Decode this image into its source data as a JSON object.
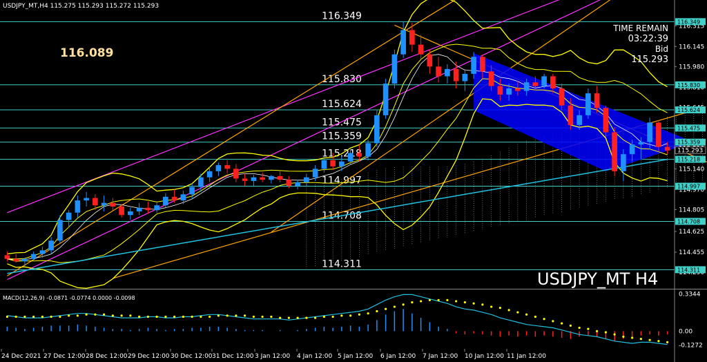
{
  "header": {
    "ohlc_text": "USDJPY_MT,H4  115.275 115.293 115.272 115.293"
  },
  "big_price": "116.089",
  "info": {
    "time_label": "TIME REMAIN",
    "time_value": "03:22:39",
    "bid_label": "Bid",
    "bid_value": "115.293"
  },
  "watermark": "USDJPY_MT H4",
  "macd_header": "MACD(12,26,9) -0.0871 -0.0774 0.0000 -0.0098",
  "colors": {
    "bg": "#000000",
    "bull": "#1e90ff",
    "bear": "#ff2020",
    "level": "#40d0c8",
    "envelope": "#ffff00",
    "channel_outer": "#ff30ff",
    "channel_inner": "#ffa500",
    "triangle": "#0000ff",
    "ema": "#20c0e0",
    "macd_signal": "#ffff00",
    "macd_line": "#20c0e0"
  },
  "chart_data": {
    "type": "candlestick",
    "symbol": "USDJPY_MT",
    "timeframe": "H4",
    "ylim": [
      114.16,
      116.47
    ],
    "y_ticks": [
      "116.315",
      "116.145",
      "115.980",
      "115.810",
      "115.645",
      "115.475",
      "115.310",
      "115.140",
      "114.970",
      "114.805",
      "114.625",
      "114.455",
      "114.290"
    ],
    "x_ticks": [
      "24 Dec 2021",
      "27 Dec 12:00",
      "28 Dec 12:00",
      "29 Dec 12:00",
      "30 Dec 12:00",
      "31 Dec 12:00",
      "3 Jan 12:00",
      "4 Jan 12:00",
      "5 Jan 12:00",
      "6 Jan 12:00",
      "7 Jan 12:00",
      "10 Jan 12:00",
      "11 Jan 12:00"
    ],
    "levels": [
      {
        "value": 116.349,
        "label": "116.349",
        "tag": "116.349"
      },
      {
        "value": 115.83,
        "label": "115.830",
        "tag": "115.830"
      },
      {
        "value": 115.624,
        "label": "115.624",
        "tag": "115.624"
      },
      {
        "value": 115.475,
        "label": "115.475",
        "tag": "115.475"
      },
      {
        "value": 115.359,
        "label": "115.359",
        "tag": "115.359"
      },
      {
        "value": 115.218,
        "label": "115.218",
        "tag": "115.218"
      },
      {
        "value": 114.997,
        "label": "114.997",
        "tag": "114.997"
      },
      {
        "value": 114.708,
        "label": "114.708",
        "tag": "114.708"
      },
      {
        "value": 114.311,
        "label": "114.311",
        "tag": "114.311"
      }
    ],
    "current_price": {
      "value": 115.293,
      "tag": "115.293"
    },
    "candles": [
      [
        114.43,
        114.46,
        114.38,
        114.4
      ],
      [
        114.4,
        114.44,
        114.37,
        114.38
      ],
      [
        114.38,
        114.41,
        114.34,
        114.4
      ],
      [
        114.4,
        114.46,
        114.39,
        114.44
      ],
      [
        114.44,
        114.5,
        114.41,
        114.47
      ],
      [
        114.47,
        114.58,
        114.44,
        114.55
      ],
      [
        114.55,
        114.76,
        114.53,
        114.72
      ],
      [
        114.72,
        114.8,
        114.66,
        114.78
      ],
      [
        114.78,
        114.92,
        114.74,
        114.88
      ],
      [
        114.88,
        114.95,
        114.83,
        114.9
      ],
      [
        114.9,
        114.93,
        114.8,
        114.84
      ],
      [
        114.84,
        114.92,
        114.79,
        114.86
      ],
      [
        114.86,
        114.9,
        114.8,
        114.83
      ],
      [
        114.83,
        114.85,
        114.74,
        114.76
      ],
      [
        114.76,
        114.82,
        114.72,
        114.79
      ],
      [
        114.79,
        114.86,
        114.76,
        114.82
      ],
      [
        114.82,
        114.87,
        114.77,
        114.8
      ],
      [
        114.8,
        114.86,
        114.78,
        114.84
      ],
      [
        114.84,
        114.94,
        114.82,
        114.91
      ],
      [
        114.91,
        114.97,
        114.86,
        114.88
      ],
      [
        114.88,
        114.96,
        114.85,
        114.93
      ],
      [
        114.93,
        115.02,
        114.89,
        114.99
      ],
      [
        114.99,
        115.1,
        114.95,
        115.07
      ],
      [
        115.07,
        115.16,
        115.03,
        115.12
      ],
      [
        115.12,
        115.19,
        115.08,
        115.17
      ],
      [
        115.17,
        115.21,
        115.1,
        115.14
      ],
      [
        115.14,
        115.18,
        115.03,
        115.06
      ],
      [
        115.06,
        115.1,
        115.0,
        115.04
      ],
      [
        115.04,
        115.09,
        115.0,
        115.07
      ],
      [
        115.07,
        115.11,
        115.03,
        115.05
      ],
      [
        115.05,
        115.09,
        115.02,
        115.08
      ],
      [
        115.08,
        115.12,
        115.03,
        115.05
      ],
      [
        115.05,
        115.08,
        114.98,
        115.0
      ],
      [
        115.0,
        115.05,
        114.97,
        115.03
      ],
      [
        115.03,
        115.1,
        115.0,
        115.07
      ],
      [
        115.07,
        115.17,
        115.04,
        115.14
      ],
      [
        115.14,
        115.25,
        115.11,
        115.21
      ],
      [
        115.21,
        115.27,
        115.13,
        115.16
      ],
      [
        115.16,
        115.24,
        115.12,
        115.2
      ],
      [
        115.2,
        115.3,
        115.17,
        115.27
      ],
      [
        115.27,
        115.34,
        115.2,
        115.24
      ],
      [
        115.24,
        115.38,
        115.21,
        115.35
      ],
      [
        115.35,
        115.62,
        115.32,
        115.58
      ],
      [
        115.58,
        115.88,
        115.55,
        115.84
      ],
      [
        115.84,
        116.12,
        115.8,
        116.08
      ],
      [
        116.08,
        116.35,
        116.05,
        116.28
      ],
      [
        116.28,
        116.34,
        116.1,
        116.16
      ],
      [
        116.16,
        116.24,
        116.04,
        116.08
      ],
      [
        116.08,
        116.12,
        115.92,
        115.98
      ],
      [
        115.98,
        116.06,
        115.85,
        115.9
      ],
      [
        115.9,
        116.0,
        115.84,
        115.96
      ],
      [
        115.96,
        116.02,
        115.8,
        115.86
      ],
      [
        115.86,
        115.96,
        115.78,
        115.92
      ],
      [
        115.92,
        116.1,
        115.88,
        116.06
      ],
      [
        116.06,
        116.08,
        115.88,
        115.94
      ],
      [
        115.94,
        115.99,
        115.78,
        115.82
      ],
      [
        115.82,
        115.88,
        115.7,
        115.75
      ],
      [
        115.75,
        115.84,
        115.7,
        115.8
      ],
      [
        115.8,
        115.86,
        115.74,
        115.78
      ],
      [
        115.78,
        115.88,
        115.74,
        115.85
      ],
      [
        115.85,
        115.9,
        115.78,
        115.82
      ],
      [
        115.82,
        115.92,
        115.8,
        115.9
      ],
      [
        115.9,
        115.92,
        115.76,
        115.8
      ],
      [
        115.8,
        115.84,
        115.62,
        115.66
      ],
      [
        115.66,
        115.72,
        115.46,
        115.5
      ],
      [
        115.5,
        115.62,
        115.46,
        115.58
      ],
      [
        115.58,
        115.8,
        115.55,
        115.76
      ],
      [
        115.76,
        115.82,
        115.6,
        115.64
      ],
      [
        115.64,
        115.66,
        115.4,
        115.44
      ],
      [
        115.44,
        115.48,
        115.08,
        115.12
      ],
      [
        115.12,
        115.3,
        115.04,
        115.26
      ],
      [
        115.26,
        115.38,
        115.2,
        115.34
      ],
      [
        115.34,
        115.4,
        115.22,
        115.36
      ],
      [
        115.36,
        115.56,
        115.3,
        115.52
      ],
      [
        115.52,
        115.54,
        115.28,
        115.32
      ],
      [
        115.32,
        115.36,
        115.26,
        115.29
      ]
    ],
    "macd": {
      "ylim": [
        -0.16,
        0.37
      ],
      "y_ticks": [
        "0.3344",
        "0.00",
        "-0.1272"
      ],
      "histogram": [
        0.04,
        0.03,
        0.02,
        0.03,
        0.04,
        0.05,
        0.05,
        0.05,
        0.06,
        0.05,
        0.04,
        0.03,
        0.02,
        0.02,
        0.01,
        0.02,
        0.03,
        0.02,
        0.01,
        0.02,
        0.02,
        0.03,
        0.03,
        0.04,
        0.04,
        0.03,
        0.02,
        0.01,
        0.01,
        0.01,
        0.0,
        0.01,
        0.0,
        0.01,
        0.02,
        0.03,
        0.04,
        0.03,
        0.04,
        0.05,
        0.04,
        0.06,
        0.1,
        0.15,
        0.18,
        0.2,
        0.16,
        0.12,
        0.08,
        0.04,
        0.02,
        -0.02,
        -0.03,
        -0.02,
        -0.03,
        -0.04,
        -0.05,
        -0.04,
        -0.05,
        -0.04,
        -0.05,
        -0.04,
        -0.05,
        -0.06,
        -0.07,
        -0.05,
        -0.04,
        -0.05,
        -0.07,
        -0.09,
        -0.07,
        -0.05,
        -0.04,
        -0.03,
        -0.04,
        -0.03
      ],
      "macd_line": [
        0.14,
        0.13,
        0.12,
        0.12,
        0.12,
        0.13,
        0.14,
        0.15,
        0.16,
        0.16,
        0.15,
        0.14,
        0.13,
        0.12,
        0.12,
        0.12,
        0.13,
        0.13,
        0.12,
        0.12,
        0.13,
        0.13,
        0.14,
        0.15,
        0.15,
        0.14,
        0.13,
        0.12,
        0.11,
        0.11,
        0.11,
        0.11,
        0.1,
        0.11,
        0.12,
        0.13,
        0.14,
        0.15,
        0.16,
        0.17,
        0.18,
        0.2,
        0.24,
        0.28,
        0.31,
        0.33,
        0.33,
        0.31,
        0.29,
        0.27,
        0.25,
        0.22,
        0.2,
        0.19,
        0.17,
        0.15,
        0.12,
        0.1,
        0.08,
        0.06,
        0.05,
        0.04,
        0.03,
        0.01,
        -0.01,
        -0.03,
        -0.04,
        -0.05,
        -0.07,
        -0.09,
        -0.1,
        -0.11,
        -0.1,
        -0.1,
        -0.11,
        -0.12
      ],
      "signal_line": [
        0.13,
        0.13,
        0.13,
        0.13,
        0.13,
        0.13,
        0.13,
        0.14,
        0.14,
        0.15,
        0.15,
        0.15,
        0.14,
        0.14,
        0.14,
        0.13,
        0.13,
        0.13,
        0.13,
        0.13,
        0.13,
        0.13,
        0.13,
        0.13,
        0.14,
        0.14,
        0.14,
        0.14,
        0.13,
        0.13,
        0.13,
        0.12,
        0.12,
        0.12,
        0.12,
        0.12,
        0.13,
        0.13,
        0.14,
        0.14,
        0.15,
        0.16,
        0.18,
        0.2,
        0.22,
        0.24,
        0.26,
        0.27,
        0.28,
        0.28,
        0.28,
        0.27,
        0.26,
        0.25,
        0.24,
        0.22,
        0.21,
        0.19,
        0.17,
        0.15,
        0.13,
        0.11,
        0.09,
        0.07,
        0.05,
        0.03,
        0.02,
        0.0,
        -0.01,
        -0.03,
        -0.05,
        -0.06,
        -0.07,
        -0.08,
        -0.09,
        -0.1
      ]
    }
  }
}
